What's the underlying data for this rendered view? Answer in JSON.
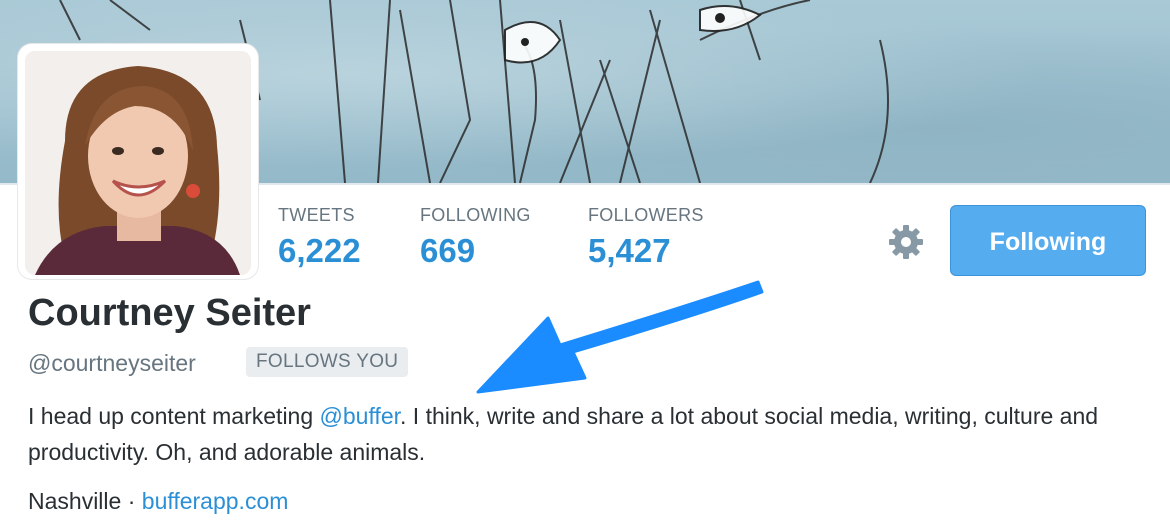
{
  "profile": {
    "name": "Courtney Seiter",
    "handle": "@courtneyseiter",
    "follows_you": "FOLLOWS YOU",
    "bio": {
      "before": "I head up content marketing ",
      "mention": "@buffer",
      "after": ". I think, write and share a lot about social media, writing, culture and productivity. Oh, and adorable animals."
    },
    "location": "Nashville",
    "separator": " · ",
    "website": "bufferapp.com"
  },
  "stats": {
    "tweets": {
      "label": "TWEETS",
      "value": "6,222"
    },
    "following": {
      "label": "FOLLOWING",
      "value": "669"
    },
    "followers": {
      "label": "FOLLOWERS",
      "value": "5,427"
    }
  },
  "actions": {
    "follow_button": "Following",
    "settings_icon": "gear-icon"
  },
  "colors": {
    "accent": "#55acee",
    "link": "#2b8fd6",
    "annotation_arrow": "#1a8cff"
  }
}
